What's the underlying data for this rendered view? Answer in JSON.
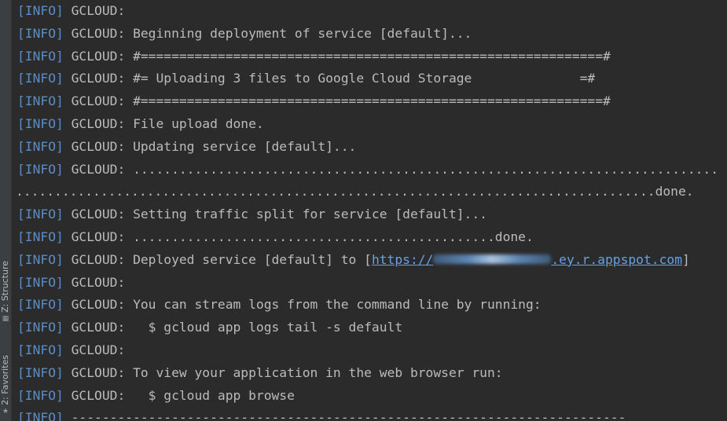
{
  "sidebar": {
    "tabs": [
      {
        "label": "Z: Structure",
        "icon": "structure-icon"
      },
      {
        "label": "2: Favorites",
        "icon": "favorites-star-icon"
      }
    ]
  },
  "console": {
    "tag": "[INFO]",
    "prefix": "GCLOUD:",
    "lines": [
      {
        "tagged": true,
        "text": ""
      },
      {
        "tagged": true,
        "text": "Beginning deployment of service [default]..."
      },
      {
        "tagged": true,
        "text": "#============================================================#"
      },
      {
        "tagged": true,
        "text": "#= Uploading 3 files to Google Cloud Storage              =#"
      },
      {
        "tagged": true,
        "text": "#============================================================#"
      },
      {
        "tagged": true,
        "text": "File upload done."
      },
      {
        "tagged": true,
        "text": "Updating service [default]..."
      },
      {
        "tagged": true,
        "text": "............................................................................"
      },
      {
        "tagged": false,
        "text": "...................................................................................done."
      },
      {
        "tagged": true,
        "text": "Setting traffic split for service [default]..."
      },
      {
        "tagged": true,
        "text": "...............................................done."
      },
      {
        "tagged": true,
        "text": "Deployed service [default] to [",
        "link_text": "https://",
        "link_text_after": ".ey.r.appspot.com",
        "after": "]"
      },
      {
        "tagged": true,
        "text": ""
      },
      {
        "tagged": true,
        "text": "You can stream logs from the command line by running:"
      },
      {
        "tagged": true,
        "text": "  $ gcloud app logs tail -s default"
      },
      {
        "tagged": true,
        "text": ""
      },
      {
        "tagged": true,
        "text": "To view your application in the web browser run:"
      },
      {
        "tagged": true,
        "text": "  $ gcloud app browse"
      },
      {
        "tagged": true,
        "text": "",
        "raw_after_tag": "------------------------------------------------------------------------"
      }
    ]
  }
}
